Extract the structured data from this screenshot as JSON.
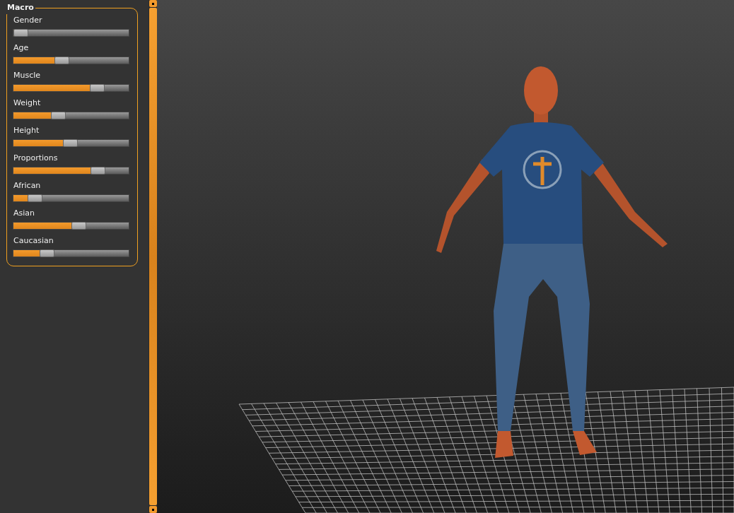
{
  "panel": {
    "title": "Macro",
    "sliders": [
      {
        "label": "Gender",
        "level": 0
      },
      {
        "label": "Age",
        "level": 0.41
      },
      {
        "label": "Muscle",
        "level": 0.76
      },
      {
        "label": "Weight",
        "level": 0.37
      },
      {
        "label": "Height",
        "level": 0.49
      },
      {
        "label": "Proportions",
        "level": 0.77
      },
      {
        "label": "African",
        "level": 0.14
      },
      {
        "label": "Asian",
        "level": 0.58
      },
      {
        "label": "Caucasian",
        "level": 0.26
      }
    ]
  }
}
